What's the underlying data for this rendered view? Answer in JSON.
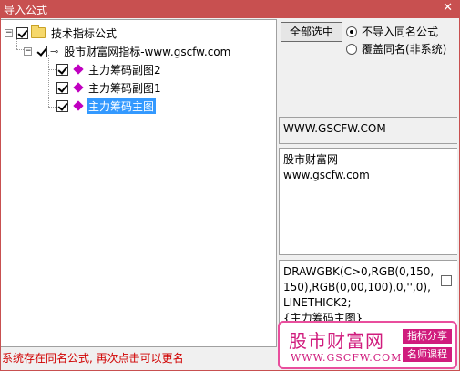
{
  "window": {
    "title": "导入公式",
    "close_glyph": "✕"
  },
  "tree": {
    "root": {
      "label": "技术指标公式",
      "expander": "−",
      "checked": true
    },
    "group": {
      "label": "股市财富网指标-www.gscfw.com",
      "expander": "−",
      "checked": true
    },
    "items": [
      {
        "label": "主力筹码副图2",
        "checked": true,
        "selected": false
      },
      {
        "label": "主力筹码副图1",
        "checked": true,
        "selected": false
      },
      {
        "label": "主力筹码主图",
        "checked": true,
        "selected": true
      }
    ]
  },
  "options": {
    "select_all_label": "全部选中",
    "radio_skip_label": "不导入同名公式",
    "radio_overwrite_label": "覆盖同名(非系统)",
    "selected_radio": "skip"
  },
  "info": {
    "url": "WWW.GSCFW.COM",
    "desc_line1": "股市财富网",
    "desc_line2": "www.gscfw.com",
    "code": "DRAWGBK(C>0,RGB(0,150,150),RGB(0,00,100),0,'',0),LINETHICK2;\n{主力筹码主图}"
  },
  "status_message": "系统存在同名公式, 再次点击可以更名",
  "watermark": {
    "title": "股市财富网",
    "url": "WWW.GSCFW.COM",
    "tag1": "指标分享",
    "tag2": "名师课程"
  },
  "colors": {
    "titlebar": "#c85050",
    "selection": "#3399ff",
    "status": "#d00000",
    "watermark": "#d01c7d"
  }
}
